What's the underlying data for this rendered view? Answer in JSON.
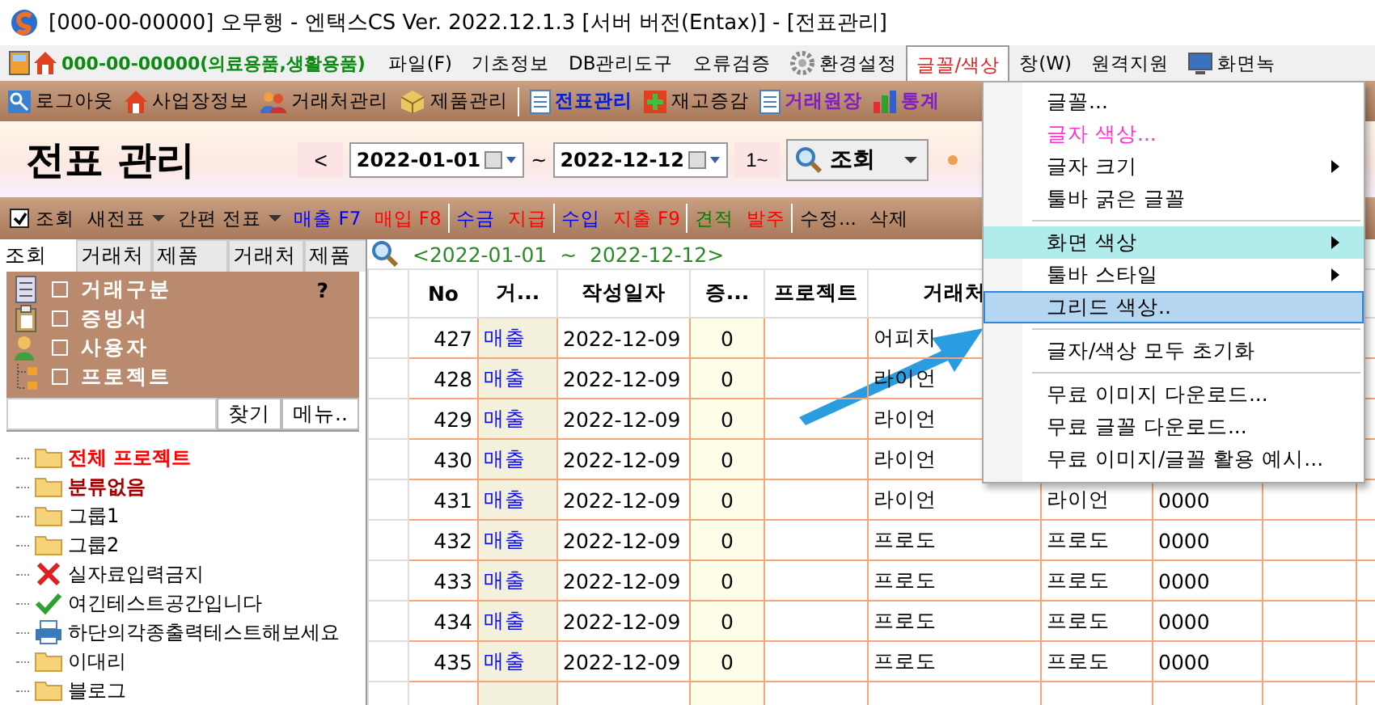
{
  "window": {
    "title": "[000-00-00000] 오무행 - 엔택스CS Ver. 2022.12.1.3 [서버 버전(Entax)] - [전표관리]"
  },
  "menubar": {
    "company": "000-00-00000(의료용품,생활용품)",
    "items": [
      {
        "label": "파일(F)",
        "kind": "plain",
        "selected": false
      },
      {
        "label": "기초정보",
        "kind": "plain",
        "selected": false
      },
      {
        "label": "DB관리도구",
        "kind": "plain",
        "selected": false
      },
      {
        "label": "오류검증",
        "kind": "plain",
        "selected": false
      },
      {
        "label": "환경설정",
        "kind": "settings",
        "selected": false
      },
      {
        "label": "글꼴/색상",
        "kind": "plain",
        "selected": true
      },
      {
        "label": "창(W)",
        "kind": "plain",
        "selected": false
      },
      {
        "label": "원격지원",
        "kind": "plain",
        "selected": false
      },
      {
        "label": "화면녹",
        "kind": "screen",
        "selected": false
      }
    ]
  },
  "toolbar": {
    "items": [
      {
        "label": "로그아웃",
        "kind": "logout"
      },
      {
        "label": "사업장정보",
        "kind": "site"
      },
      {
        "label": "거래처관리",
        "kind": "partner"
      },
      {
        "label": "제품관리",
        "kind": "product"
      },
      {
        "label": "전표관리",
        "kind": "voucher"
      },
      {
        "label": "재고증감",
        "kind": "stock"
      },
      {
        "label": "거래원장",
        "kind": "ledger"
      },
      {
        "label": "통계",
        "kind": "stats"
      }
    ]
  },
  "header": {
    "title": "전표 관리",
    "prev": "<",
    "date_from": "2022-01-01",
    "tilde": "~",
    "date_to": "2022-12-12",
    "range_button": "1~",
    "search_button": "조회"
  },
  "actionbar": {
    "items": [
      {
        "label": "조회",
        "kind": "checkbox",
        "checked": true
      },
      {
        "label": "새전표",
        "kind": "dropdown"
      },
      {
        "label": "간편 전표",
        "kind": "dropdown"
      },
      {
        "label": "매출 F7",
        "kind": "link",
        "color": "#0000ff"
      },
      {
        "label": "매입 F8",
        "kind": "link",
        "color": "#ff0000"
      },
      {
        "kind": "separator"
      },
      {
        "label": "수금",
        "kind": "link",
        "color": "#0000ff"
      },
      {
        "label": "지급",
        "kind": "link",
        "color": "#ff0000"
      },
      {
        "kind": "separator"
      },
      {
        "label": "수입",
        "kind": "link",
        "color": "#0000ff"
      },
      {
        "label": "지출 F9",
        "kind": "link",
        "color": "#ff0000"
      },
      {
        "kind": "separator"
      },
      {
        "label": "견적",
        "kind": "link",
        "color": "#008000"
      },
      {
        "label": "발주",
        "kind": "link",
        "color": "#ff0000"
      },
      {
        "kind": "separator"
      },
      {
        "label": "수정...",
        "kind": "link",
        "color": "#000000"
      },
      {
        "label": "삭제",
        "kind": "link",
        "color": "#000000"
      }
    ]
  },
  "sidebar": {
    "tabs": [
      {
        "label": "조회",
        "selected": true
      },
      {
        "label": "거래처",
        "selected": false
      },
      {
        "label": "제품",
        "selected": false
      },
      {
        "label": "거래처",
        "selected": false
      },
      {
        "label": "제품",
        "selected": false
      }
    ],
    "filters": [
      {
        "label": "거래구분",
        "kind": "list",
        "checked": false
      },
      {
        "label": "증빙서",
        "kind": "clipboard",
        "checked": false
      },
      {
        "label": "사용자",
        "kind": "user",
        "checked": false
      },
      {
        "label": "프로젝트",
        "kind": "tree",
        "checked": false
      }
    ],
    "help": "?",
    "find_button": "찾기",
    "menu_button": "메뉴..",
    "tree": [
      {
        "label": "전체 프로젝트",
        "kind": "folder",
        "bold": true,
        "color": "#ff0000"
      },
      {
        "label": "분류없음",
        "kind": "folder",
        "bold": true,
        "color": "#a00000"
      },
      {
        "label": "그룹1",
        "kind": "folder",
        "bold": false,
        "color": "#000000"
      },
      {
        "label": "그룹2",
        "kind": "folder",
        "bold": false,
        "color": "#000000"
      },
      {
        "label": "실자료입력금지",
        "kind": "blocked",
        "bold": false,
        "color": "#000000"
      },
      {
        "label": "여긴테스트공간입니다",
        "kind": "check",
        "bold": false,
        "color": "#000000"
      },
      {
        "label": "하단의각종출력테스트해보세요",
        "kind": "printer",
        "bold": false,
        "color": "#000000"
      },
      {
        "label": "이대리",
        "kind": "folder",
        "bold": false,
        "color": "#000000"
      },
      {
        "label": "블로그",
        "kind": "folder",
        "bold": false,
        "color": "#000000"
      }
    ]
  },
  "grid": {
    "filter_text": "<2022-01-01  ~  2022-12-12>",
    "columns": [
      "No",
      "거...",
      "작성일자",
      "증...",
      "프로젝트",
      "거래처"
    ],
    "rows": [
      {
        "no": "427",
        "type": "매출",
        "date": "2022-12-09",
        "count": "0",
        "partner": "어피치"
      },
      {
        "no": "428",
        "type": "매출",
        "date": "2022-12-09",
        "count": "0",
        "partner": "라이언"
      },
      {
        "no": "429",
        "type": "매출",
        "date": "2022-12-09",
        "count": "0",
        "partner": "라이언"
      },
      {
        "no": "430",
        "type": "매출",
        "date": "2022-12-09",
        "count": "0",
        "partner": "라이언"
      },
      {
        "no": "431",
        "type": "매출",
        "date": "2022-12-09",
        "count": "0",
        "partner": "라이언",
        "column_8": "라이언",
        "column_9": "0000"
      },
      {
        "no": "432",
        "type": "매출",
        "date": "2022-12-09",
        "count": "0",
        "partner": "프로도",
        "column_8": "프로도",
        "column_9": "0000"
      },
      {
        "no": "433",
        "type": "매출",
        "date": "2022-12-09",
        "count": "0",
        "partner": "프로도",
        "column_8": "프로도",
        "column_9": "0000"
      },
      {
        "no": "434",
        "type": "매출",
        "date": "2022-12-09",
        "count": "0",
        "partner": "프로도",
        "column_8": "프로도",
        "column_9": "0000"
      },
      {
        "no": "435",
        "type": "매출",
        "date": "2022-12-09",
        "count": "0",
        "partner": "프로도",
        "column_8": "프로도",
        "column_9": "0000"
      }
    ]
  },
  "menu": {
    "items": [
      {
        "kind": "item",
        "label": "글꼴...",
        "submenu": false,
        "hover": false,
        "selected": false
      },
      {
        "kind": "item",
        "label": "글자 색상...",
        "submenu": false,
        "hover": false,
        "selected": false,
        "color": "#ff33cc"
      },
      {
        "kind": "item",
        "label": "글자 크기",
        "submenu": true,
        "hover": false,
        "selected": false
      },
      {
        "kind": "item",
        "label": "툴바 굵은 글꼴",
        "submenu": false,
        "hover": false,
        "selected": false
      },
      {
        "kind": "separator"
      },
      {
        "kind": "item",
        "label": "화면 색상",
        "submenu": true,
        "hover": true,
        "selected": false
      },
      {
        "kind": "item",
        "label": "툴바 스타일",
        "submenu": true,
        "hover": false,
        "selected": false
      },
      {
        "kind": "item",
        "label": "그리드 색상..",
        "submenu": false,
        "hover": false,
        "selected": true
      },
      {
        "kind": "separator"
      },
      {
        "kind": "item",
        "label": "글자/색상 모두 초기화",
        "submenu": false,
        "hover": false,
        "selected": false
      },
      {
        "kind": "separator"
      },
      {
        "kind": "item",
        "label": "무료 이미지 다운로드...",
        "submenu": false,
        "hover": false,
        "selected": false
      },
      {
        "kind": "item",
        "label": "무료 글꼴 다운로드...",
        "submenu": false,
        "hover": false,
        "selected": false
      },
      {
        "kind": "item",
        "label": "무료 이미지/글꼴 활용 예시...",
        "submenu": false,
        "hover": false,
        "selected": false
      }
    ]
  }
}
